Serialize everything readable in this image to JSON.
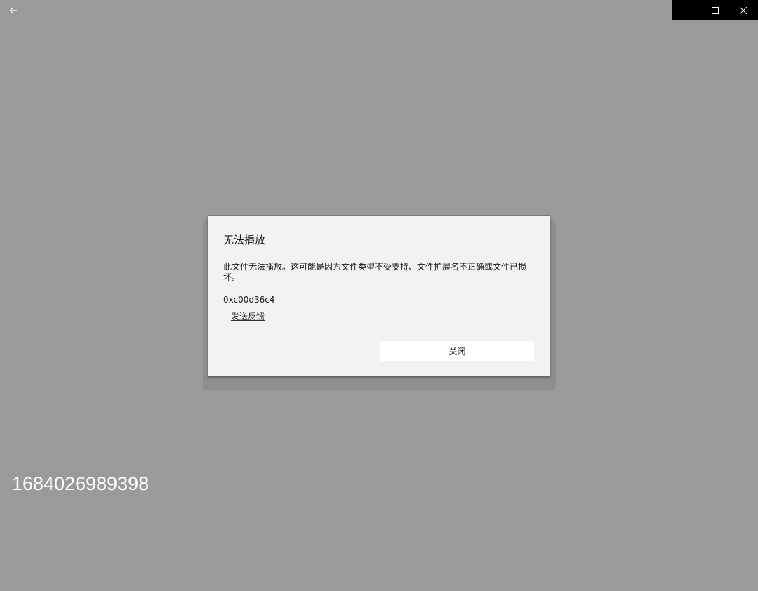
{
  "titlebar": {
    "back_icon": "arrow-left-icon",
    "controls": {
      "minimize_icon": "minimize-icon",
      "maximize_icon": "maximize-icon",
      "close_icon": "close-icon"
    }
  },
  "dialog": {
    "title": "无法播放",
    "message": "此文件无法播放。这可能是因为文件类型不受支持、文件扩展名不正确或文件已损坏。",
    "error_code": "0xc00d36c4",
    "feedback_link": "发送反馈",
    "close_button": "关闭"
  },
  "overlay_text": "1684026989398",
  "colors": {
    "background": "#9a9a9a",
    "dialog_bg": "#f2f2f2",
    "titlebar_controls_bg": "#000000",
    "text": "#1a1a1a"
  }
}
